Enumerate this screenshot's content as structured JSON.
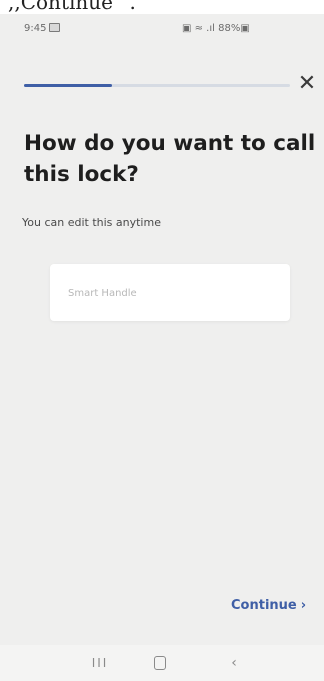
{
  "overlay_text": ",,Continue “.",
  "status_bar": {
    "time": "9:45",
    "right_text": "▣ ≈ .ıl 88%▣"
  },
  "progress": {
    "fraction": 0.33,
    "color": "#3f5fa6"
  },
  "header": {
    "close_symbol": "✕"
  },
  "main": {
    "title": "How do you want to call this lock?",
    "subtitle": "You can edit this anytime",
    "name_input": {
      "value": "",
      "placeholder": "Smart Handle"
    }
  },
  "footer": {
    "continue_label": "Continue",
    "continue_chevron": "›"
  },
  "nav_bar": {
    "recents_glyph": "III",
    "back_glyph": "‹"
  },
  "colors": {
    "accent": "#3f5fa6",
    "background": "#efefee"
  }
}
